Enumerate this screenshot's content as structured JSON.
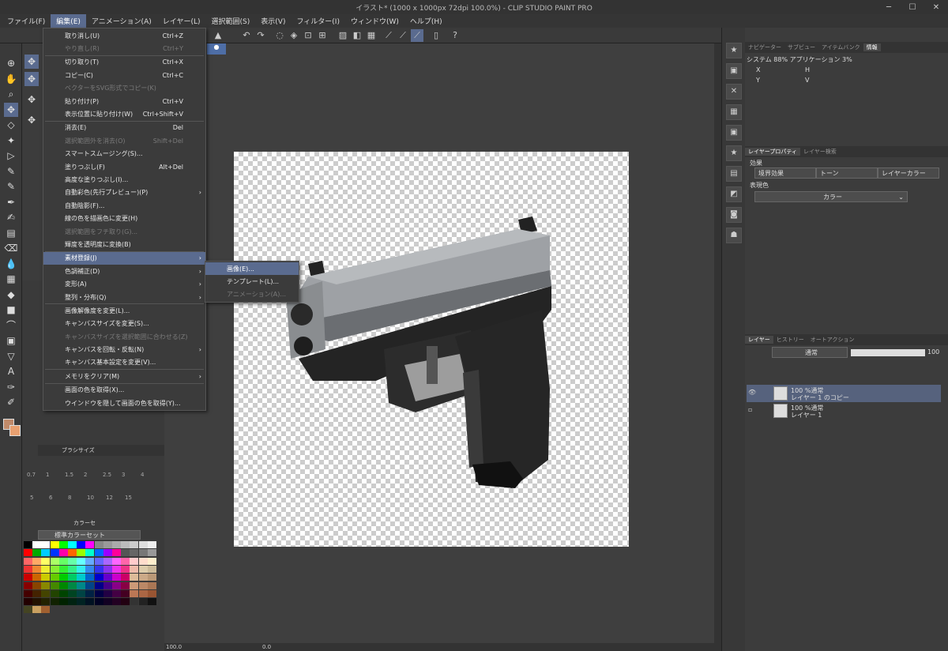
{
  "window": {
    "title": "イラスト* (1000 x 1000px 72dpi 100.0%)  - CLIP STUDIO PAINT PRO"
  },
  "menubar": [
    "ファイル(F)",
    "編集(E)",
    "アニメーション(A)",
    "レイヤー(L)",
    "選択範囲(S)",
    "表示(V)",
    "フィルター(I)",
    "ウィンドウ(W)",
    "ヘルプ(H)"
  ],
  "edit_menu": [
    {
      "label": "取り消し(U)",
      "shortcut": "Ctrl+Z",
      "disabled": false
    },
    {
      "label": "やり直し(R)",
      "shortcut": "Ctrl+Y",
      "disabled": true
    },
    {
      "sep": true
    },
    {
      "label": "切り取り(T)",
      "shortcut": "Ctrl+X",
      "disabled": false
    },
    {
      "label": "コピー(C)",
      "shortcut": "Ctrl+C",
      "disabled": false
    },
    {
      "label": "ベクターをSVG形式でコピー(K)",
      "shortcut": "",
      "disabled": true
    },
    {
      "label": "貼り付け(P)",
      "shortcut": "Ctrl+V",
      "disabled": false
    },
    {
      "label": "表示位置に貼り付け(W)",
      "shortcut": "Ctrl+Shift+V",
      "disabled": false
    },
    {
      "sep": true
    },
    {
      "label": "消去(E)",
      "shortcut": "Del",
      "disabled": false
    },
    {
      "label": "選択範囲外を消去(O)",
      "shortcut": "Shift+Del",
      "disabled": true
    },
    {
      "label": "スマートスムージング(S)...",
      "shortcut": "",
      "disabled": false
    },
    {
      "label": "塗りつぶし(F)",
      "shortcut": "Alt+Del",
      "disabled": false
    },
    {
      "label": "高度な塗りつぶし(I)...",
      "shortcut": "",
      "disabled": false
    },
    {
      "label": "自動彩色(先行プレビュー)(P)",
      "shortcut": "",
      "disabled": false,
      "submenu": true
    },
    {
      "label": "自動陰影(F)...",
      "shortcut": "",
      "disabled": false
    },
    {
      "label": "線の色を描画色に変更(H)",
      "shortcut": "",
      "disabled": false
    },
    {
      "label": "選択範囲をフチ取り(G)...",
      "shortcut": "",
      "disabled": true
    },
    {
      "label": "輝度を透明度に変換(B)",
      "shortcut": "",
      "disabled": false
    },
    {
      "sep": true
    },
    {
      "label": "素材登録(J)",
      "shortcut": "",
      "disabled": false,
      "submenu": true,
      "highlight": true
    },
    {
      "label": "色調補正(D)",
      "shortcut": "",
      "disabled": false,
      "submenu": true
    },
    {
      "label": "変形(A)",
      "shortcut": "",
      "disabled": false,
      "submenu": true
    },
    {
      "label": "整列・分布(Q)",
      "shortcut": "",
      "disabled": false,
      "submenu": true
    },
    {
      "sep": true
    },
    {
      "label": "画像解像度を変更(L)...",
      "shortcut": "",
      "disabled": false
    },
    {
      "label": "キャンバスサイズを変更(S)...",
      "shortcut": "",
      "disabled": false
    },
    {
      "label": "キャンバスサイズを選択範囲に合わせる(Z)",
      "shortcut": "",
      "disabled": true
    },
    {
      "label": "キャンバスを回転・反転(N)",
      "shortcut": "",
      "disabled": false,
      "submenu": true
    },
    {
      "label": "キャンバス基本設定を変更(V)...",
      "shortcut": "",
      "disabled": false
    },
    {
      "sep": true
    },
    {
      "label": "メモリをクリア(M)",
      "shortcut": "",
      "disabled": false,
      "submenu": true
    },
    {
      "sep": true
    },
    {
      "label": "画面の色を取得(X)...",
      "shortcut": "",
      "disabled": false
    },
    {
      "label": "ウインドウを隠して画面の色を取得(Y)...",
      "shortcut": "",
      "disabled": false
    }
  ],
  "material_submenu": [
    {
      "label": "画像(E)...",
      "disabled": false,
      "highlight": true
    },
    {
      "label": "テンプレート(L)...",
      "disabled": false
    },
    {
      "label": "アニメーション(A)...",
      "disabled": true
    }
  ],
  "info_panel": {
    "tabs": [
      "ナビゲーター",
      "サブビュー",
      "アイテムバンク",
      "情報"
    ],
    "memory": "システム 88%  アプリケーション 3%",
    "x": "X",
    "y": "Y",
    "h": "H",
    "v": "V"
  },
  "layer_property": {
    "tabs": [
      "レイヤープロパティ",
      "レイヤー検索"
    ],
    "effect_label": "効果",
    "effects": [
      "境界効果",
      "トーン",
      "レイヤーカラー"
    ],
    "color_label": "表現色",
    "color_mode": "カラー"
  },
  "layer_panel": {
    "tabs": [
      "レイヤー",
      "ヒストリー",
      "オートアクション"
    ],
    "blend": "通常",
    "opacity": "100",
    "layers": [
      {
        "line1": "100 %通常",
        "line2": "レイヤー 1 のコピー",
        "selected": true
      },
      {
        "line1": "100 %通常",
        "line2": "レイヤー 1",
        "selected": false
      }
    ]
  },
  "brush_size": {
    "tab": "ブラシサイズ",
    "sizes_row1": [
      "0.7",
      "1",
      "1.5",
      "2",
      "2.5",
      "3",
      "4"
    ],
    "sizes_row2": [
      "5",
      "6",
      "8",
      "10",
      "12",
      "15"
    ]
  },
  "color_set": {
    "tab": "カラーセ",
    "name": "標準カラーセット"
  },
  "status": {
    "zoom": "100.0",
    "angle": "0.0"
  },
  "colors": {
    "accent": "#5a6b8f",
    "main_color": "#c08a6a",
    "sub_color": "#e8a070"
  }
}
